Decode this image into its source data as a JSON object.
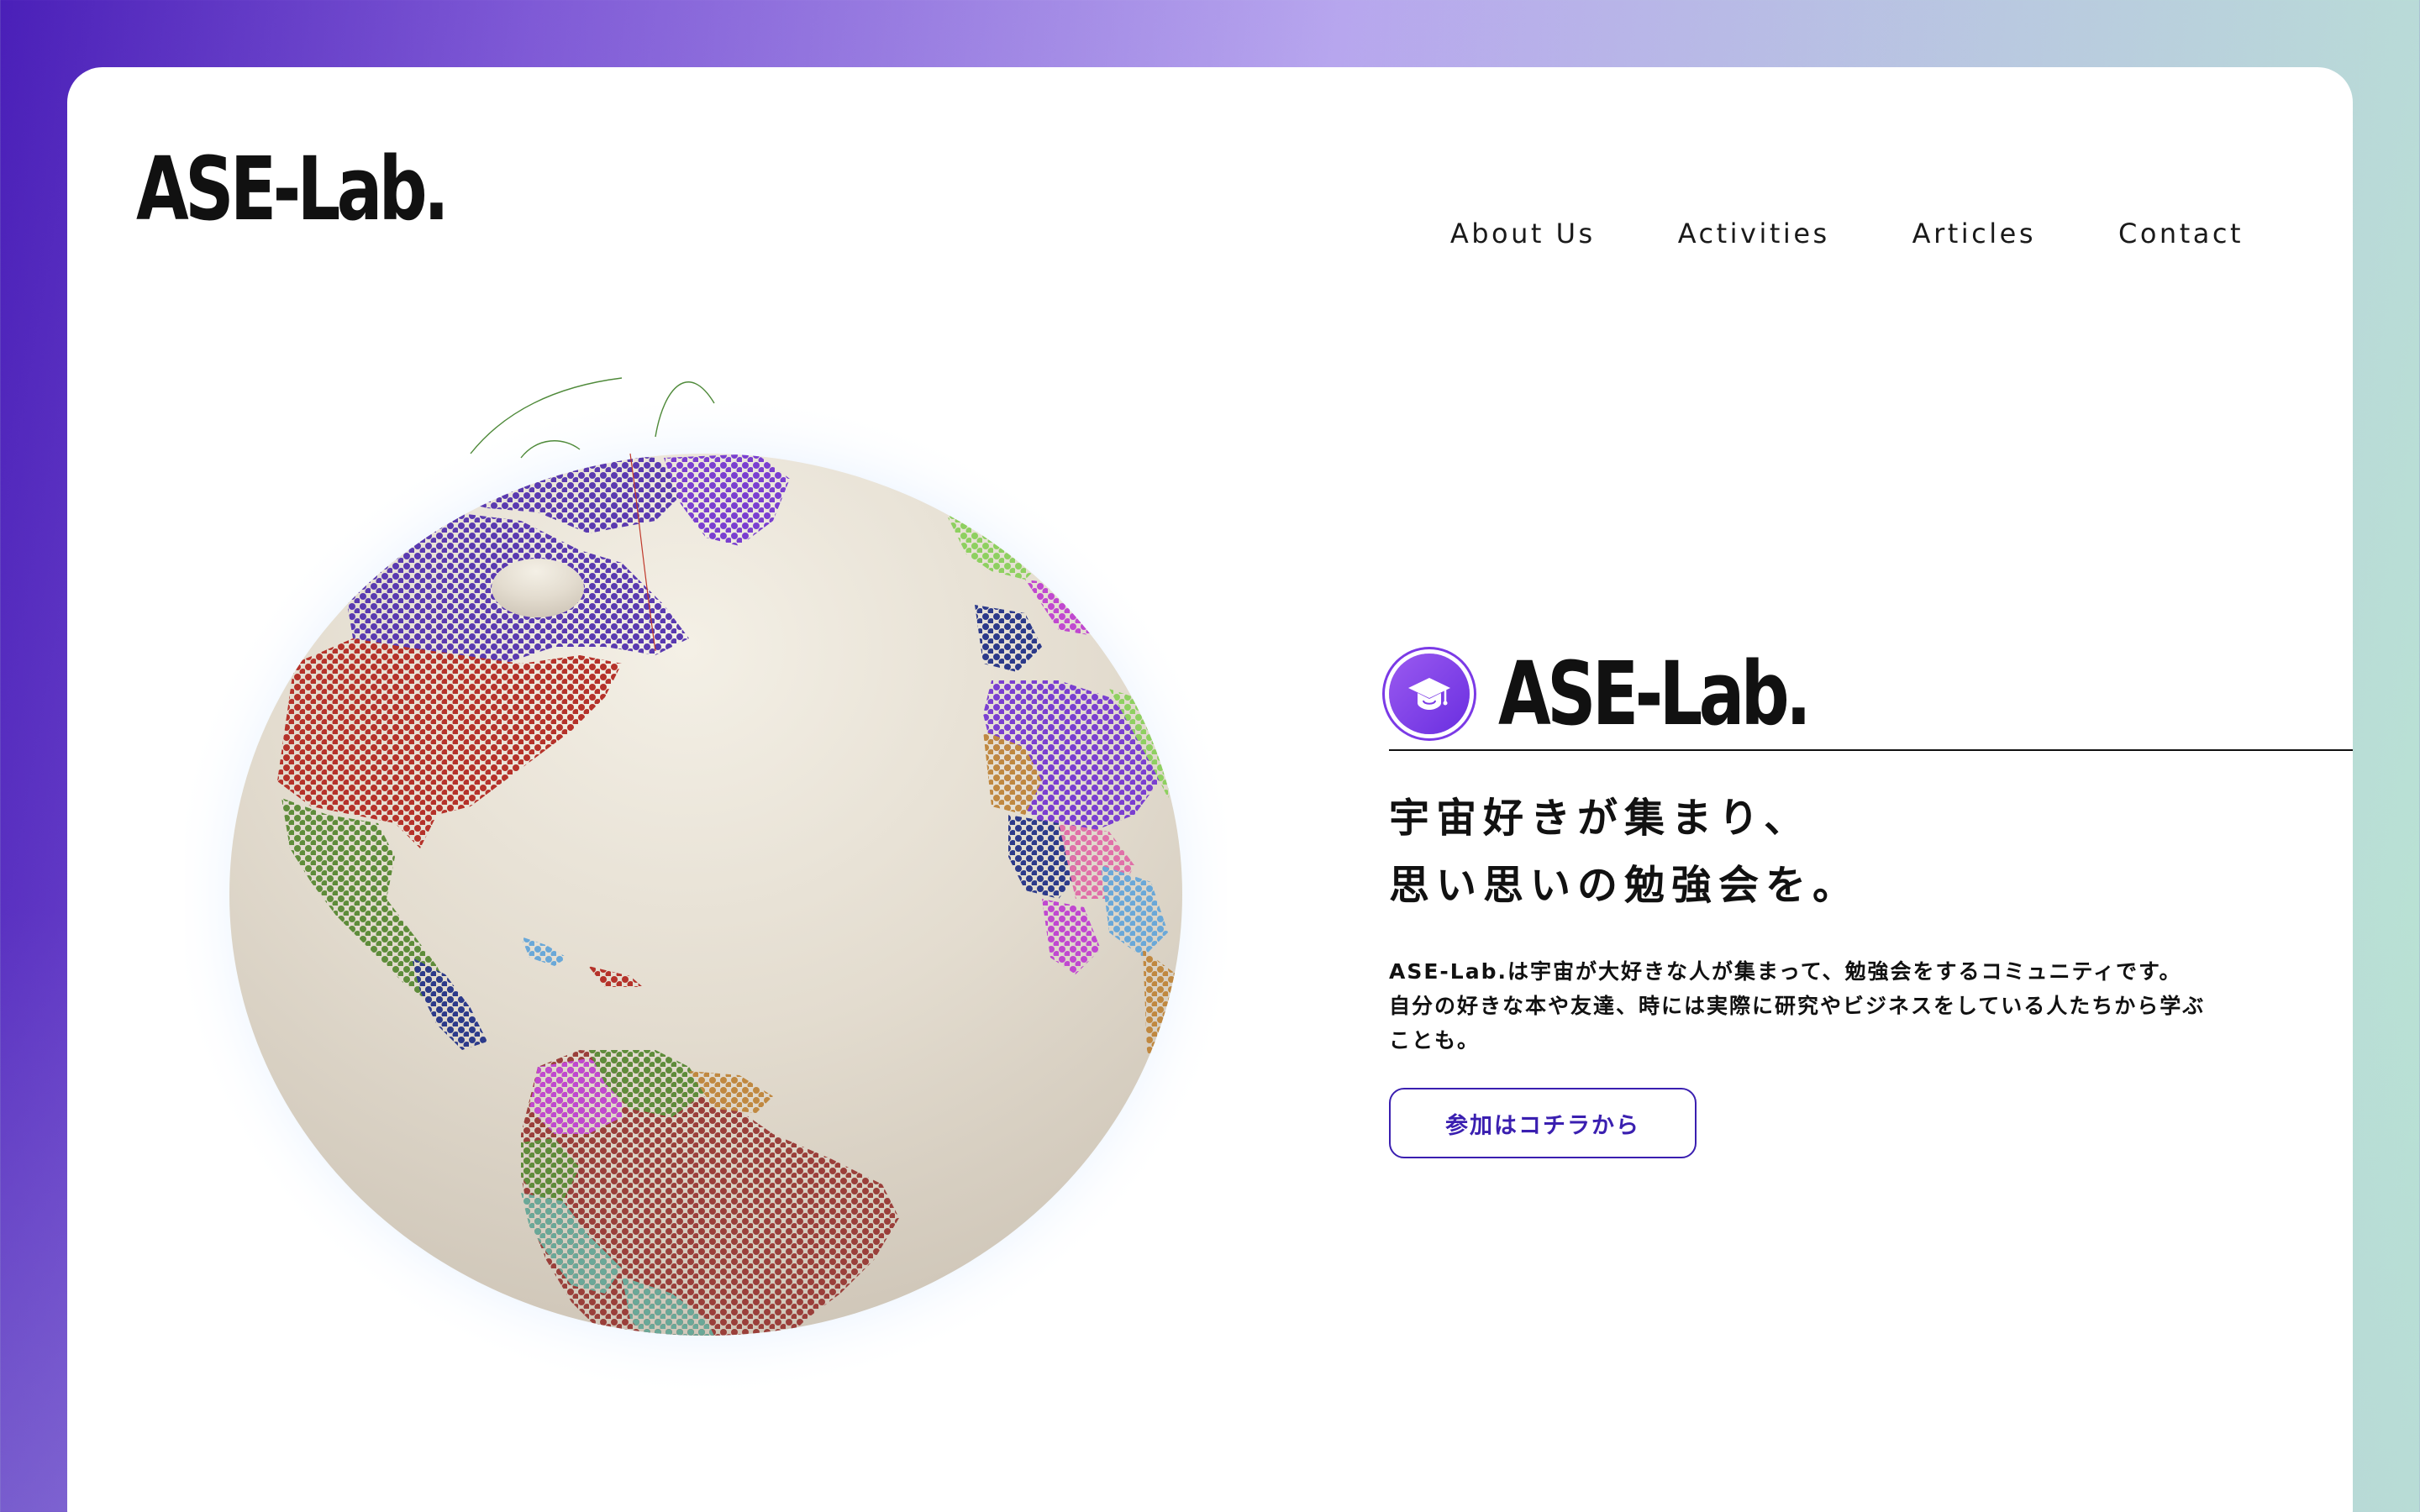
{
  "header": {
    "logo": "ASE-Lab.",
    "nav": [
      "About Us",
      "Activities",
      "Articles",
      "Contact"
    ]
  },
  "hero": {
    "title": "ASE-Lab.",
    "tagline": [
      "宇宙好きが集まり、",
      "思い思いの勉強会を。"
    ],
    "description": [
      "ASE-Lab.は宇宙が大好きな人が集まって、勉強会をするコミュニティです。",
      "自分の好きな本や友達、時には実際に研究やビジネスをしている人たちから学ぶ",
      "ことも。"
    ],
    "cta_label": "参加はコチラから"
  },
  "icons": {
    "hero_icon": "graduation-cap-icon",
    "globe": "world-globe"
  },
  "colors": {
    "accent": "#3a1fb0",
    "icon_gradient_start": "#9a5af0",
    "icon_gradient_end": "#6a2ee0",
    "globe_base": "#ddd5c8",
    "text": "#111111"
  }
}
